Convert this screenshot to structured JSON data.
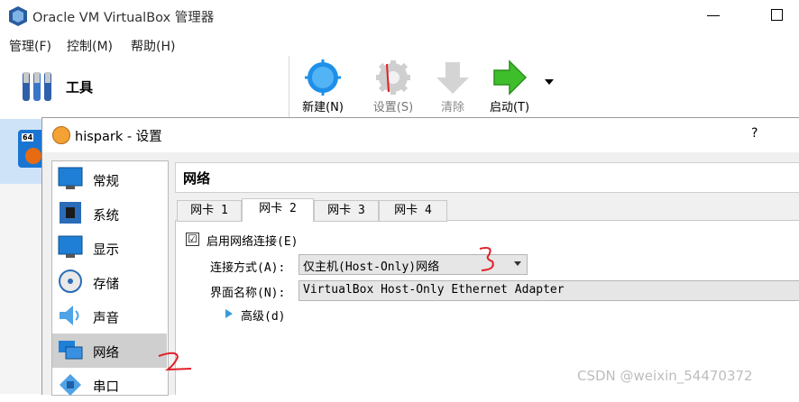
{
  "window": {
    "title": "Oracle VM VirtualBox 管理器"
  },
  "menu": [
    "管理(F)",
    "控制(M)",
    "帮助(H)"
  ],
  "tools": {
    "label": "工具"
  },
  "toolbar": {
    "new_label": "新建(N)",
    "settings_label": "设置(S)",
    "discard_label": "清除",
    "start_label": "启动(T)"
  },
  "vm": {
    "badge": "64"
  },
  "dialog": {
    "title": "hispark - 设置",
    "help": "?",
    "nav": [
      "常规",
      "系统",
      "显示",
      "存储",
      "声音",
      "网络",
      "串口"
    ],
    "selected_nav": "网络",
    "section_title": "网络",
    "tabs": [
      "网卡 1",
      "网卡 2",
      "网卡 3",
      "网卡 4"
    ],
    "active_tab": "网卡 2",
    "enable_label": "启用网络连接(E)",
    "enable_checked": "☑",
    "attached_label": "连接方式(A):",
    "attached_value": "仅主机(Host-Only)网络",
    "name_label": "界面名称(N):",
    "name_value": "VirtualBox Host-Only Ethernet Adapter",
    "advanced_label": "高级(d)"
  },
  "watermark": "CSDN @weixin_54470372",
  "colors": {
    "accent_blue": "#1a75d2",
    "selection_gray": "#cfcfcf",
    "annotation_red": "#e0202a"
  }
}
